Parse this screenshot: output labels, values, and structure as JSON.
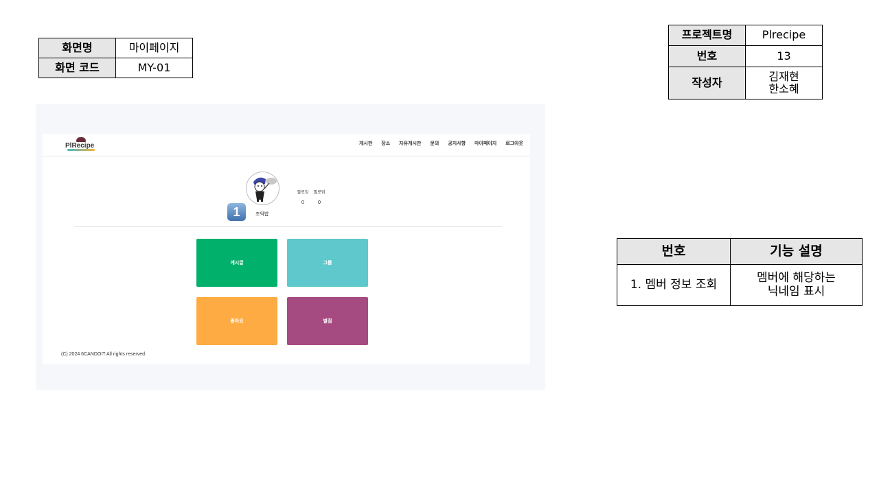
{
  "screen_info": {
    "screen_name_label": "화면명",
    "screen_name_value": "마이페이지",
    "screen_code_label": "화면 코드",
    "screen_code_value": "MY-01"
  },
  "project_info": {
    "project_label": "프로젝트명",
    "project_value": "Plrecipe",
    "number_label": "번호",
    "number_value": "13",
    "author_label": "작성자",
    "author_line1": "김재현",
    "author_line2": "한소혜"
  },
  "feature_table": {
    "col_number": "번호",
    "col_description": "기능 설명",
    "rows": [
      {
        "number": "1. 멤버 정보 조회",
        "description_line1": "멤버에 해당하는",
        "description_line2": "닉네임 표시"
      }
    ]
  },
  "app": {
    "logo_text": "PlRecipe",
    "nav": [
      "게시판",
      "장소",
      "자유게시판",
      "문의",
      "공지사항",
      "마이페이지",
      "로그아웃"
    ],
    "profile": {
      "rank": "1",
      "nickname": "조억밥",
      "followers_label": "팔로잉",
      "followers_count": "0",
      "following_label": "팔로워",
      "following_count": "0"
    },
    "tiles": [
      {
        "label": "게시글",
        "color": "#00b06b"
      },
      {
        "label": "그룹",
        "color": "#5ec8cc"
      },
      {
        "label": "좋아요",
        "color": "#fdab42"
      },
      {
        "label": "별점",
        "color": "#a64a82"
      }
    ],
    "footer": "(C) 2024 6CANDOIT All rights reserved."
  }
}
